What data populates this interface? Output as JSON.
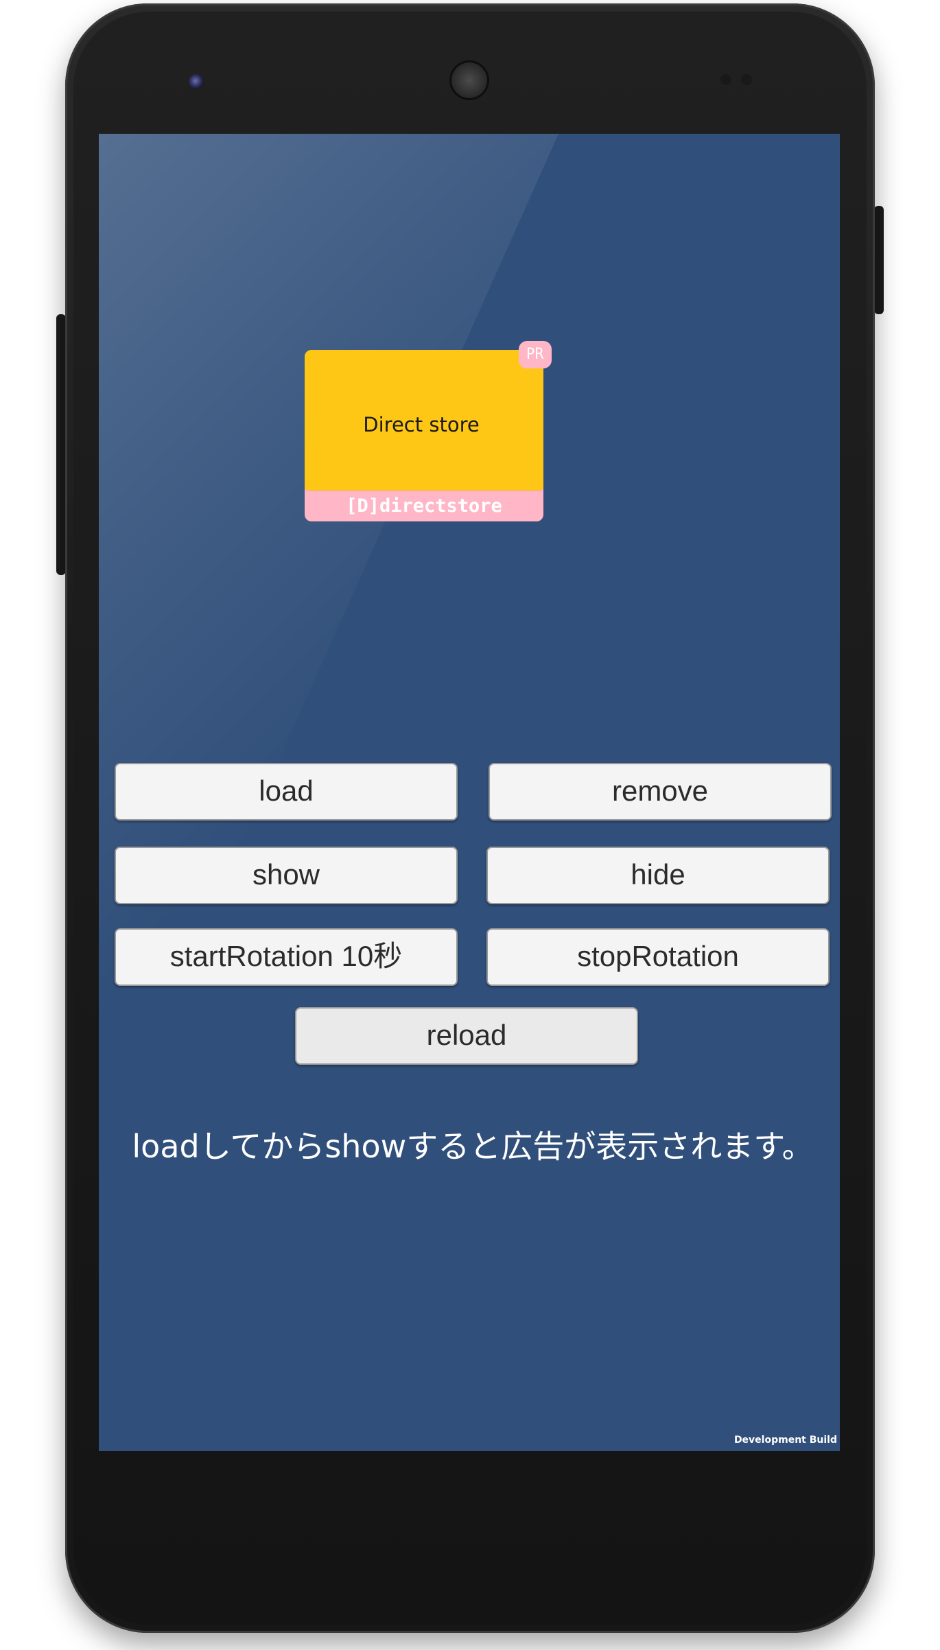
{
  "ad": {
    "image_text": "Direct store",
    "label": "[D]directstore",
    "badge": "PR",
    "colors": {
      "image_bg": "#ffc715",
      "frame_bg": "#ffb7c8",
      "label_text": "#ffffff"
    }
  },
  "buttons": {
    "load": "load",
    "remove": "remove",
    "show": "show",
    "hide": "hide",
    "start_rotation": "startRotation 10秒",
    "stop_rotation": "stopRotation",
    "reload": "reload"
  },
  "message": "loadしてからshowすると広告が表示されます。",
  "footer": {
    "build_label": "Development Build"
  },
  "colors": {
    "screen_bg": "#304f7a",
    "button_bg": "#f4f4f5",
    "button_text": "#2b2b2b",
    "message_text": "#ffffff"
  },
  "device": {
    "front_icons": [
      "front-camera-icon",
      "speaker-grille-icon",
      "sensor-icon"
    ]
  }
}
